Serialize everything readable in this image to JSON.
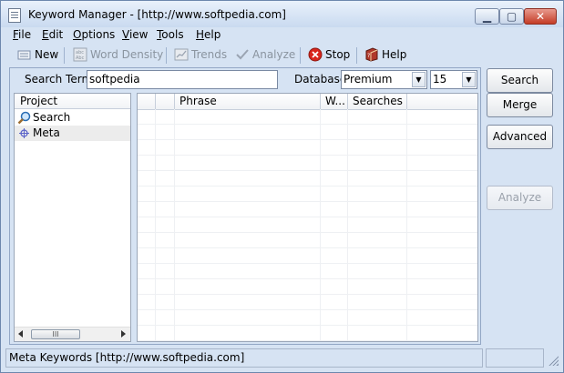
{
  "window": {
    "title": "Keyword Manager - [http://www.softpedia.com]",
    "controls": {
      "minimize": "▁",
      "maximize": "▢",
      "close": "✕"
    }
  },
  "menu": [
    "File",
    "Edit",
    "Options",
    "View",
    "Tools",
    "Help"
  ],
  "toolbar": {
    "new": "New",
    "word_density": "Word Density",
    "trends": "Trends",
    "analyze": "Analyze",
    "stop": "Stop",
    "help": "Help"
  },
  "search": {
    "label": "Search Term:",
    "value": "softpedia",
    "database_label": "Database:",
    "database_value": "Premium",
    "count_value": "15"
  },
  "project_tree": {
    "header": "Project",
    "items": [
      {
        "label": "Search",
        "icon": "magnifier-icon"
      },
      {
        "label": "Meta",
        "icon": "meta-icon",
        "selected": true
      }
    ],
    "scroll_thumb": "III"
  },
  "results_grid": {
    "columns": [
      "",
      "",
      "Phrase",
      "W...",
      "Searches",
      ""
    ],
    "rows": []
  },
  "side_buttons": {
    "search": "Search",
    "merge": "Merge",
    "advanced": "Advanced",
    "analyze": "Analyze"
  },
  "status": {
    "text": "Meta Keywords [http://www.softpedia.com]",
    "secondary": ""
  },
  "colors": {
    "window_bg": "#d6e3f3",
    "stop_red": "#d9251c",
    "help_red": "#b0382a"
  }
}
